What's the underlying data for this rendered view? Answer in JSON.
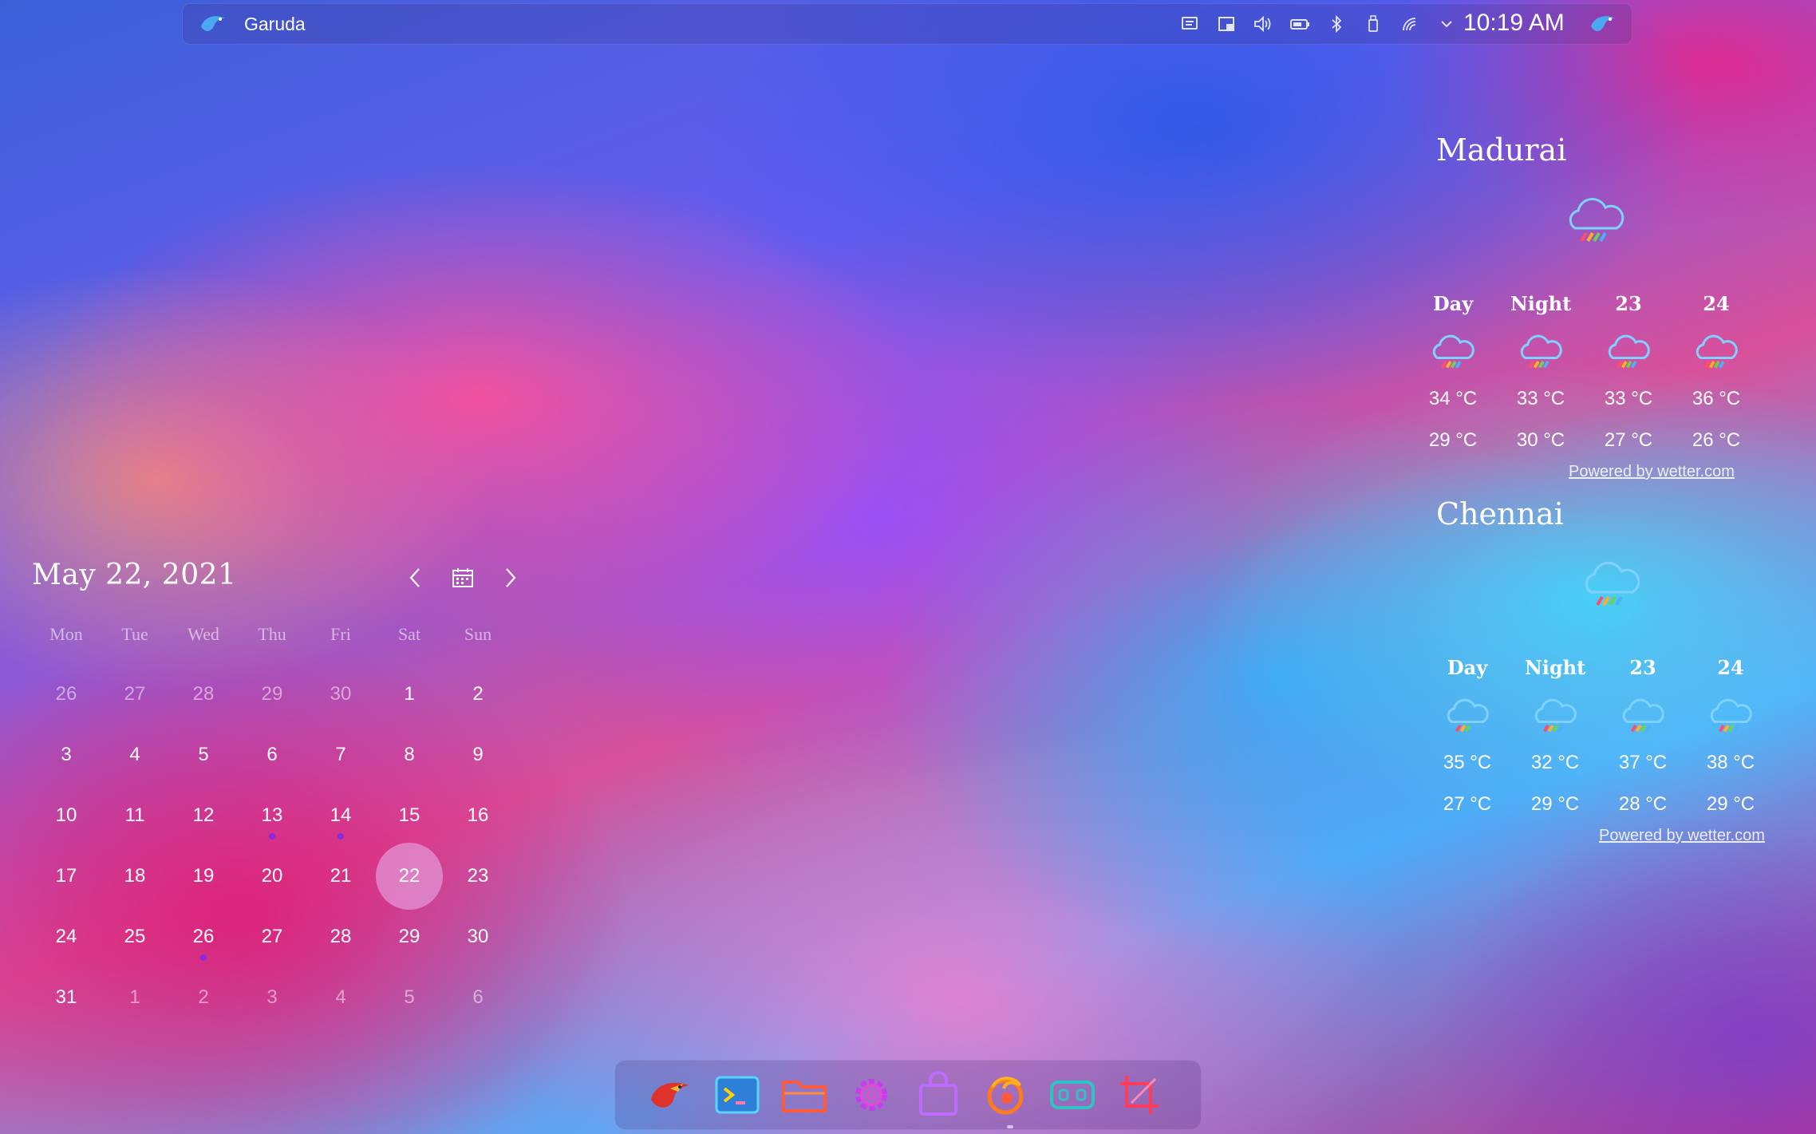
{
  "panel": {
    "title": "Garuda",
    "clock": "10:19 AM",
    "tray_icons": [
      "clipboard-icon",
      "window-icon",
      "volume-icon",
      "battery-icon",
      "bluetooth-icon",
      "usb-icon",
      "network-icon",
      "expand-chevron-icon"
    ]
  },
  "calendar": {
    "title": "May 22, 2021",
    "weekdays": [
      "Mon",
      "Tue",
      "Wed",
      "Thu",
      "Fri",
      "Sat",
      "Sun"
    ],
    "days": [
      [
        "26",
        "27",
        "28",
        "29",
        "30",
        "1",
        "2"
      ],
      [
        "3",
        "4",
        "5",
        "6",
        "7",
        "8",
        "9"
      ],
      [
        "10",
        "11",
        "12",
        "13",
        "14",
        "15",
        "16"
      ],
      [
        "17",
        "18",
        "19",
        "20",
        "21",
        "22",
        "23"
      ],
      [
        "24",
        "25",
        "26",
        "27",
        "28",
        "29",
        "30"
      ],
      [
        "31",
        "1",
        "2",
        "3",
        "4",
        "5",
        "6"
      ]
    ],
    "selected": "22"
  },
  "weather": [
    {
      "city": "Madurai",
      "headers": [
        "Day",
        "Night",
        "23",
        "24"
      ],
      "highs": [
        "34 °C",
        "33 °C",
        "33 °C",
        "36 °C"
      ],
      "lows": [
        "29 °C",
        "30 °C",
        "27 °C",
        "26 °C"
      ],
      "powered": "Powered by wetter.com"
    },
    {
      "city": "Chennai",
      "headers": [
        "Day",
        "Night",
        "23",
        "24"
      ],
      "highs": [
        "35 °C",
        "32 °C",
        "37 °C",
        "38 °C"
      ],
      "lows": [
        "27 °C",
        "29 °C",
        "28 °C",
        "29 °C"
      ],
      "powered": "Powered by wetter.com"
    }
  ],
  "dock": {
    "items": [
      "garuda-eagle-icon",
      "terminal-icon",
      "file-manager-icon",
      "settings-gear-icon",
      "software-store-icon",
      "firefox-icon",
      "game-controller-icon",
      "screenshot-crop-icon"
    ]
  }
}
